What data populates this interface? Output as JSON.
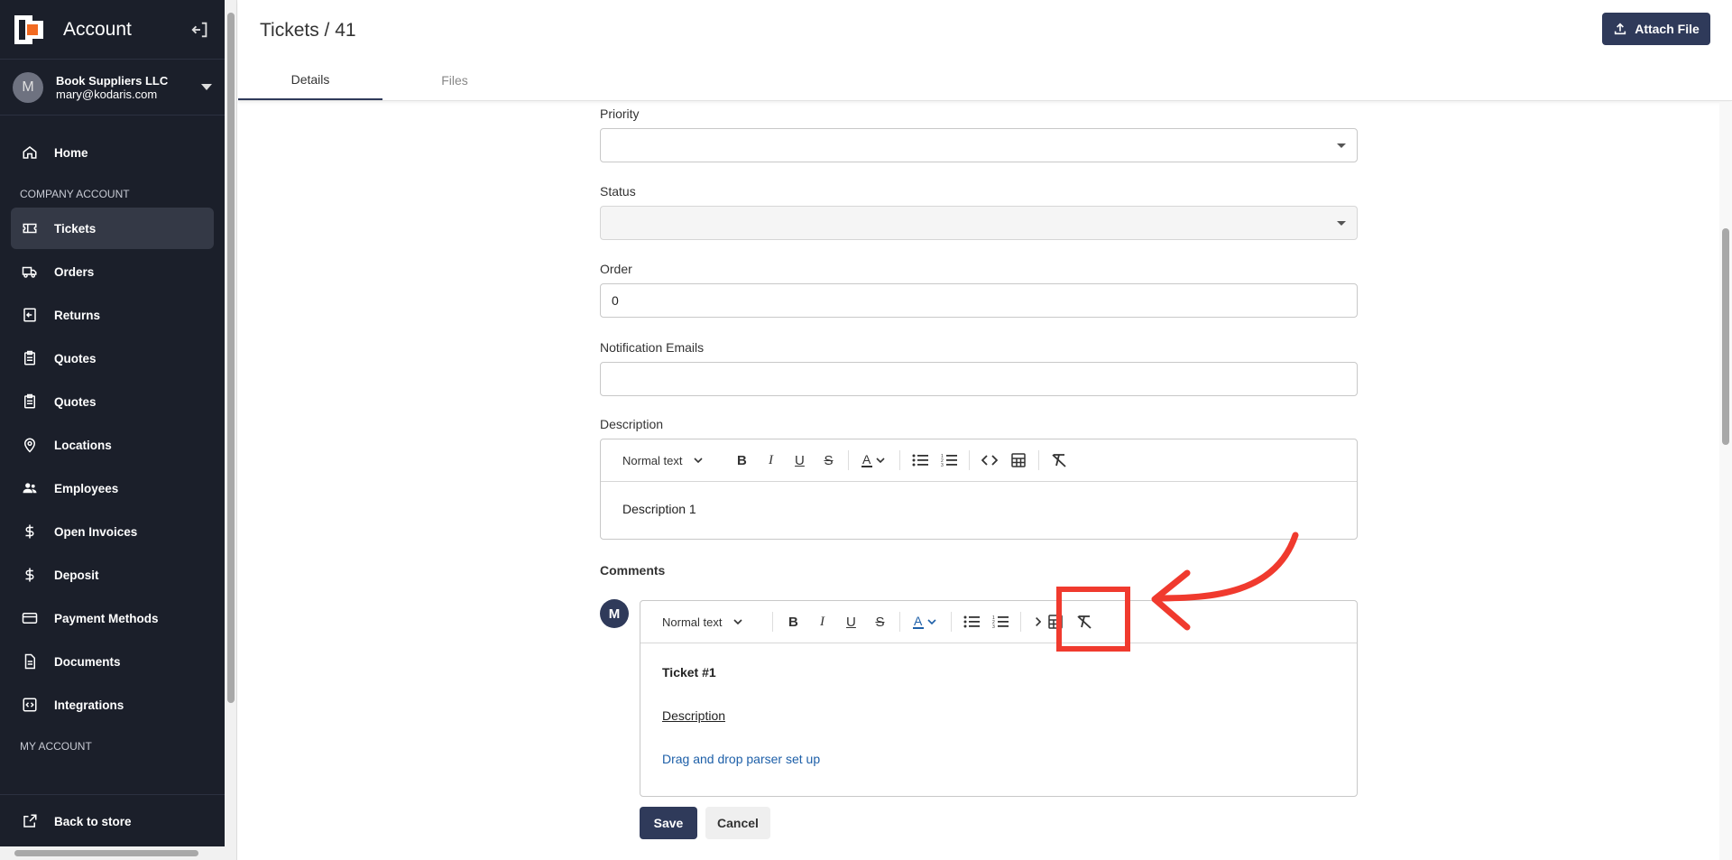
{
  "sidebar": {
    "title": "Account",
    "user": {
      "initial": "M",
      "company": "Book Suppliers LLC",
      "email": "mary@kodaris.com"
    },
    "items": [
      {
        "label": "Home",
        "icon": "home-icon"
      },
      {
        "label": "Tickets",
        "icon": "ticket-icon"
      },
      {
        "label": "Orders",
        "icon": "truck-icon"
      },
      {
        "label": "Returns",
        "icon": "return-icon"
      },
      {
        "label": "Quotes",
        "icon": "clipboard-icon"
      },
      {
        "label": "Quotes",
        "icon": "clipboard-icon"
      },
      {
        "label": "Locations",
        "icon": "location-pin-icon"
      },
      {
        "label": "Employees",
        "icon": "people-icon"
      },
      {
        "label": "Open Invoices",
        "icon": "dollar-icon"
      },
      {
        "label": "Deposit",
        "icon": "dollar-icon"
      },
      {
        "label": "Payment Methods",
        "icon": "credit-card-icon"
      },
      {
        "label": "Documents",
        "icon": "document-icon"
      },
      {
        "label": "Integrations",
        "icon": "integration-icon"
      }
    ],
    "sections": {
      "company": "COMPANY ACCOUNT",
      "my": "MY ACCOUNT"
    },
    "footer": {
      "label": "Back to store",
      "icon": "external-link-icon"
    }
  },
  "header": {
    "title": "Tickets / 41",
    "attach_label": "Attach File",
    "tabs": [
      "Details",
      "Files"
    ]
  },
  "form": {
    "priority": {
      "label": "Priority",
      "value": ""
    },
    "status": {
      "label": "Status",
      "value": ""
    },
    "order": {
      "label": "Order",
      "value": "0"
    },
    "notification": {
      "label": "Notification Emails",
      "value": ""
    },
    "description": {
      "label": "Description",
      "text_style": "Normal text",
      "body": "Description 1"
    },
    "comments": {
      "label": "Comments",
      "avatar": "M",
      "text_style": "Normal text",
      "line1": "Ticket #1",
      "line2": "Description",
      "line3": "Drag and drop parser set up"
    },
    "save_label": "Save",
    "cancel_label": "Cancel"
  },
  "colors": {
    "sidebar_bg": "#1b1f2a",
    "primary": "#2f3a5a",
    "annotation": "#f03a2e",
    "link": "#1d5fa8"
  }
}
